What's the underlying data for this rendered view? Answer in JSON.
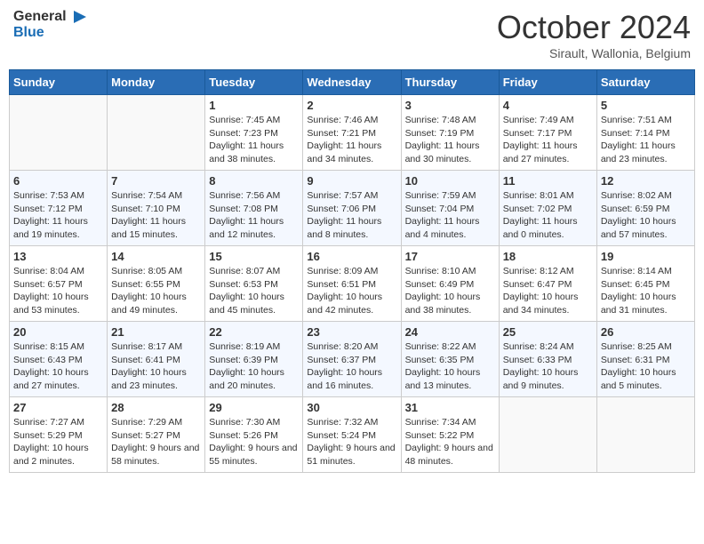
{
  "header": {
    "logo_line1": "General",
    "logo_line2": "Blue",
    "month": "October 2024",
    "location": "Sirault, Wallonia, Belgium"
  },
  "days_of_week": [
    "Sunday",
    "Monday",
    "Tuesday",
    "Wednesday",
    "Thursday",
    "Friday",
    "Saturday"
  ],
  "weeks": [
    [
      {
        "day": "",
        "info": ""
      },
      {
        "day": "",
        "info": ""
      },
      {
        "day": "1",
        "info": "Sunrise: 7:45 AM\nSunset: 7:23 PM\nDaylight: 11 hours and 38 minutes."
      },
      {
        "day": "2",
        "info": "Sunrise: 7:46 AM\nSunset: 7:21 PM\nDaylight: 11 hours and 34 minutes."
      },
      {
        "day": "3",
        "info": "Sunrise: 7:48 AM\nSunset: 7:19 PM\nDaylight: 11 hours and 30 minutes."
      },
      {
        "day": "4",
        "info": "Sunrise: 7:49 AM\nSunset: 7:17 PM\nDaylight: 11 hours and 27 minutes."
      },
      {
        "day": "5",
        "info": "Sunrise: 7:51 AM\nSunset: 7:14 PM\nDaylight: 11 hours and 23 minutes."
      }
    ],
    [
      {
        "day": "6",
        "info": "Sunrise: 7:53 AM\nSunset: 7:12 PM\nDaylight: 11 hours and 19 minutes."
      },
      {
        "day": "7",
        "info": "Sunrise: 7:54 AM\nSunset: 7:10 PM\nDaylight: 11 hours and 15 minutes."
      },
      {
        "day": "8",
        "info": "Sunrise: 7:56 AM\nSunset: 7:08 PM\nDaylight: 11 hours and 12 minutes."
      },
      {
        "day": "9",
        "info": "Sunrise: 7:57 AM\nSunset: 7:06 PM\nDaylight: 11 hours and 8 minutes."
      },
      {
        "day": "10",
        "info": "Sunrise: 7:59 AM\nSunset: 7:04 PM\nDaylight: 11 hours and 4 minutes."
      },
      {
        "day": "11",
        "info": "Sunrise: 8:01 AM\nSunset: 7:02 PM\nDaylight: 11 hours and 0 minutes."
      },
      {
        "day": "12",
        "info": "Sunrise: 8:02 AM\nSunset: 6:59 PM\nDaylight: 10 hours and 57 minutes."
      }
    ],
    [
      {
        "day": "13",
        "info": "Sunrise: 8:04 AM\nSunset: 6:57 PM\nDaylight: 10 hours and 53 minutes."
      },
      {
        "day": "14",
        "info": "Sunrise: 8:05 AM\nSunset: 6:55 PM\nDaylight: 10 hours and 49 minutes."
      },
      {
        "day": "15",
        "info": "Sunrise: 8:07 AM\nSunset: 6:53 PM\nDaylight: 10 hours and 45 minutes."
      },
      {
        "day": "16",
        "info": "Sunrise: 8:09 AM\nSunset: 6:51 PM\nDaylight: 10 hours and 42 minutes."
      },
      {
        "day": "17",
        "info": "Sunrise: 8:10 AM\nSunset: 6:49 PM\nDaylight: 10 hours and 38 minutes."
      },
      {
        "day": "18",
        "info": "Sunrise: 8:12 AM\nSunset: 6:47 PM\nDaylight: 10 hours and 34 minutes."
      },
      {
        "day": "19",
        "info": "Sunrise: 8:14 AM\nSunset: 6:45 PM\nDaylight: 10 hours and 31 minutes."
      }
    ],
    [
      {
        "day": "20",
        "info": "Sunrise: 8:15 AM\nSunset: 6:43 PM\nDaylight: 10 hours and 27 minutes."
      },
      {
        "day": "21",
        "info": "Sunrise: 8:17 AM\nSunset: 6:41 PM\nDaylight: 10 hours and 23 minutes."
      },
      {
        "day": "22",
        "info": "Sunrise: 8:19 AM\nSunset: 6:39 PM\nDaylight: 10 hours and 20 minutes."
      },
      {
        "day": "23",
        "info": "Sunrise: 8:20 AM\nSunset: 6:37 PM\nDaylight: 10 hours and 16 minutes."
      },
      {
        "day": "24",
        "info": "Sunrise: 8:22 AM\nSunset: 6:35 PM\nDaylight: 10 hours and 13 minutes."
      },
      {
        "day": "25",
        "info": "Sunrise: 8:24 AM\nSunset: 6:33 PM\nDaylight: 10 hours and 9 minutes."
      },
      {
        "day": "26",
        "info": "Sunrise: 8:25 AM\nSunset: 6:31 PM\nDaylight: 10 hours and 5 minutes."
      }
    ],
    [
      {
        "day": "27",
        "info": "Sunrise: 7:27 AM\nSunset: 5:29 PM\nDaylight: 10 hours and 2 minutes."
      },
      {
        "day": "28",
        "info": "Sunrise: 7:29 AM\nSunset: 5:27 PM\nDaylight: 9 hours and 58 minutes."
      },
      {
        "day": "29",
        "info": "Sunrise: 7:30 AM\nSunset: 5:26 PM\nDaylight: 9 hours and 55 minutes."
      },
      {
        "day": "30",
        "info": "Sunrise: 7:32 AM\nSunset: 5:24 PM\nDaylight: 9 hours and 51 minutes."
      },
      {
        "day": "31",
        "info": "Sunrise: 7:34 AM\nSunset: 5:22 PM\nDaylight: 9 hours and 48 minutes."
      },
      {
        "day": "",
        "info": ""
      },
      {
        "day": "",
        "info": ""
      }
    ]
  ]
}
